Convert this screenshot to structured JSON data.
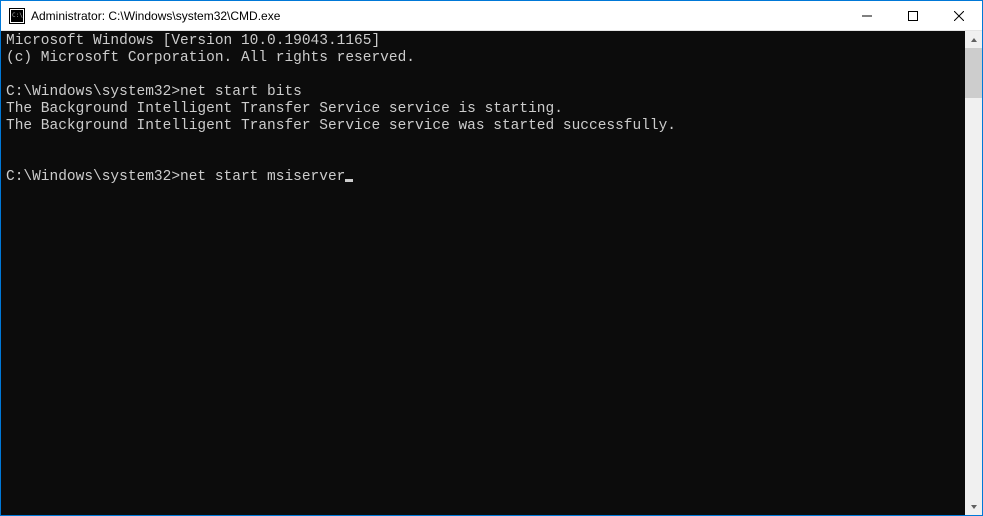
{
  "titlebar": {
    "title": "Administrator: C:\\Windows\\system32\\CMD.exe"
  },
  "terminal": {
    "line1": "Microsoft Windows [Version 10.0.19043.1165]",
    "line2": "(c) Microsoft Corporation. All rights reserved.",
    "prompt1": "C:\\Windows\\system32>",
    "command1": "net start bits",
    "output1": "The Background Intelligent Transfer Service service is starting.",
    "output2": "The Background Intelligent Transfer Service service was started successfully.",
    "prompt2": "C:\\Windows\\system32>",
    "command2": "net start msiserver"
  }
}
